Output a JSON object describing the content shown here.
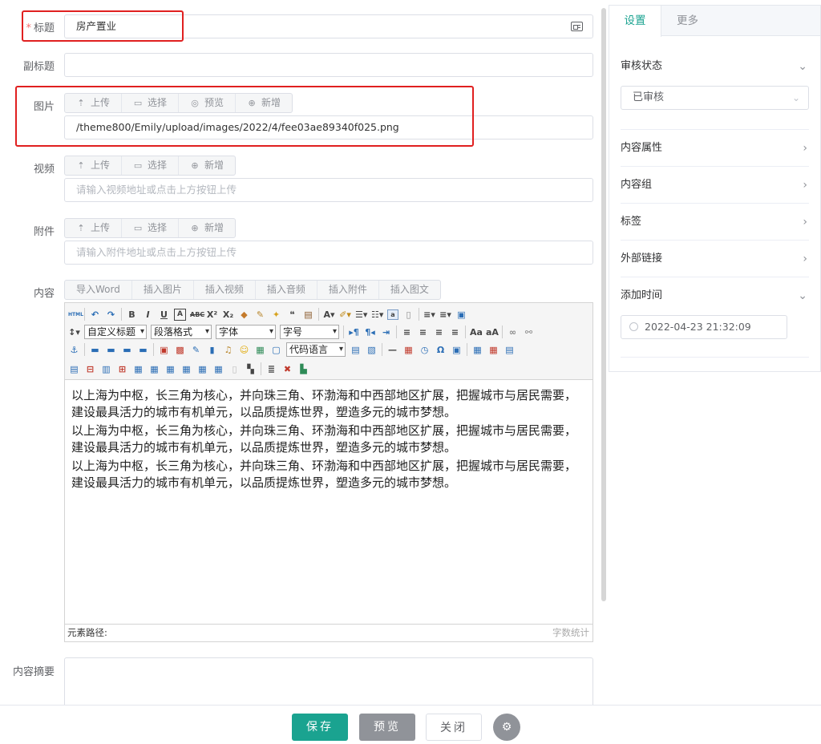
{
  "form": {
    "title_label": "标题",
    "required_mark": "*",
    "title_value": "房产置业",
    "subtitle_label": "副标题",
    "subtitle_value": "",
    "image_label": "图片",
    "image_path": "/theme800/Emily/upload/images/2022/4/fee03ae89340f025.png",
    "video_label": "视频",
    "video_placeholder": "请输入视频地址或点击上方按钮上传",
    "attachment_label": "附件",
    "attachment_placeholder": "请输入附件地址或点击上方按钮上传",
    "content_label": "内容",
    "summary_label": "内容摘要"
  },
  "image_buttons": {
    "upload": "上传",
    "choose": "选择",
    "preview": "预览",
    "add": "新增"
  },
  "video_buttons": {
    "upload": "上传",
    "choose": "选择",
    "add": "新增"
  },
  "attachment_buttons": {
    "upload": "上传",
    "choose": "选择",
    "add": "新增"
  },
  "content_tabs": [
    "导入Word",
    "插入图片",
    "插入视频",
    "插入音频",
    "插入附件",
    "插入图文"
  ],
  "editor": {
    "custom_title": "自定义标题",
    "paragraph_format": "段落格式",
    "font": "字体",
    "font_size": "字号",
    "code_language": "代码语言",
    "paragraphs": [
      "以上海为中枢，长三角为核心，并向珠三角、环渤海和中西部地区扩展，把握城市与居民需要，建设最具活力的城市有机单元，以品质提炼世界，塑造多元的城市梦想。",
      "以上海为中枢，长三角为核心，并向珠三角、环渤海和中西部地区扩展，把握城市与居民需要，建设最具活力的城市有机单元，以品质提炼世界，塑造多元的城市梦想。",
      "以上海为中枢，长三角为核心，并向珠三角、环渤海和中西部地区扩展，把握城市与居民需要，建设最具活力的城市有机单元，以品质提炼世界，塑造多元的城市梦想。"
    ],
    "element_path": "元素路径:",
    "word_count": "字数统计"
  },
  "sidebar": {
    "tab_settings": "设置",
    "tab_more": "更多",
    "review_status_label": "审核状态",
    "review_status_value": "已审核",
    "content_attributes": "内容属性",
    "content_group": "内容组",
    "tags": "标签",
    "external_link": "外部链接",
    "add_time_label": "添加时间",
    "add_time_value": "2022-04-23 21:32:09"
  },
  "footer": {
    "save": "保存",
    "preview": "预览",
    "close": "关闭"
  },
  "colors": {
    "accent": "#1aa390",
    "highlight_box": "#e02020",
    "gray_button": "#909399"
  }
}
